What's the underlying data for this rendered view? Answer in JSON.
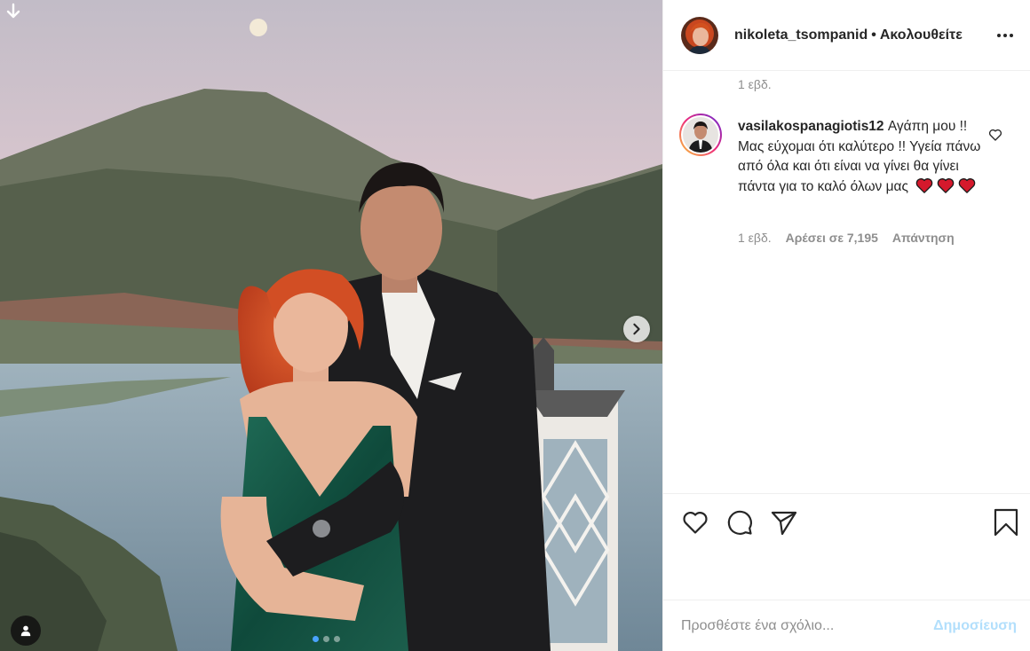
{
  "post": {
    "carousel": {
      "slide_count": 3,
      "active_index": 0
    },
    "icons": {
      "download": "arrow-down-icon",
      "next": "chevron-right-icon",
      "tagged_users": "user-icon"
    }
  },
  "header": {
    "username": "nikoleta_tsompanid",
    "separator": "•",
    "follow_label": "Ακολουθείτε",
    "more_icon": "more-dots-icon"
  },
  "previous_comment_meta": {
    "time": "1 εβδ."
  },
  "comment": {
    "username": "vasilakospanagiotis12",
    "text": "Αγάπη μου !! Μας εύχομαι ότι καλύτερο !! Υγεία πάνω από όλα και ότι είναι να γίνει θα γίνει πάντα για το καλό όλων μας",
    "emoji_count": 3,
    "time": "1 εβδ.",
    "likes": "Αρέσει σε 7,195",
    "reply": "Απάντηση",
    "like_icon": "heart-outline-icon"
  },
  "actions": {
    "like_icon": "heart-outline-icon",
    "comment_icon": "speech-bubble-icon",
    "share_icon": "paper-plane-icon",
    "save_icon": "bookmark-icon"
  },
  "add_comment": {
    "placeholder": "Προσθέστε ένα σχόλιο...",
    "post_label": "Δημοσίευση"
  },
  "colors": {
    "text": "#262626",
    "secondary": "#8e8e8e",
    "post_button_disabled": "#b2dffc",
    "heart_emoji": "#d5192c"
  }
}
